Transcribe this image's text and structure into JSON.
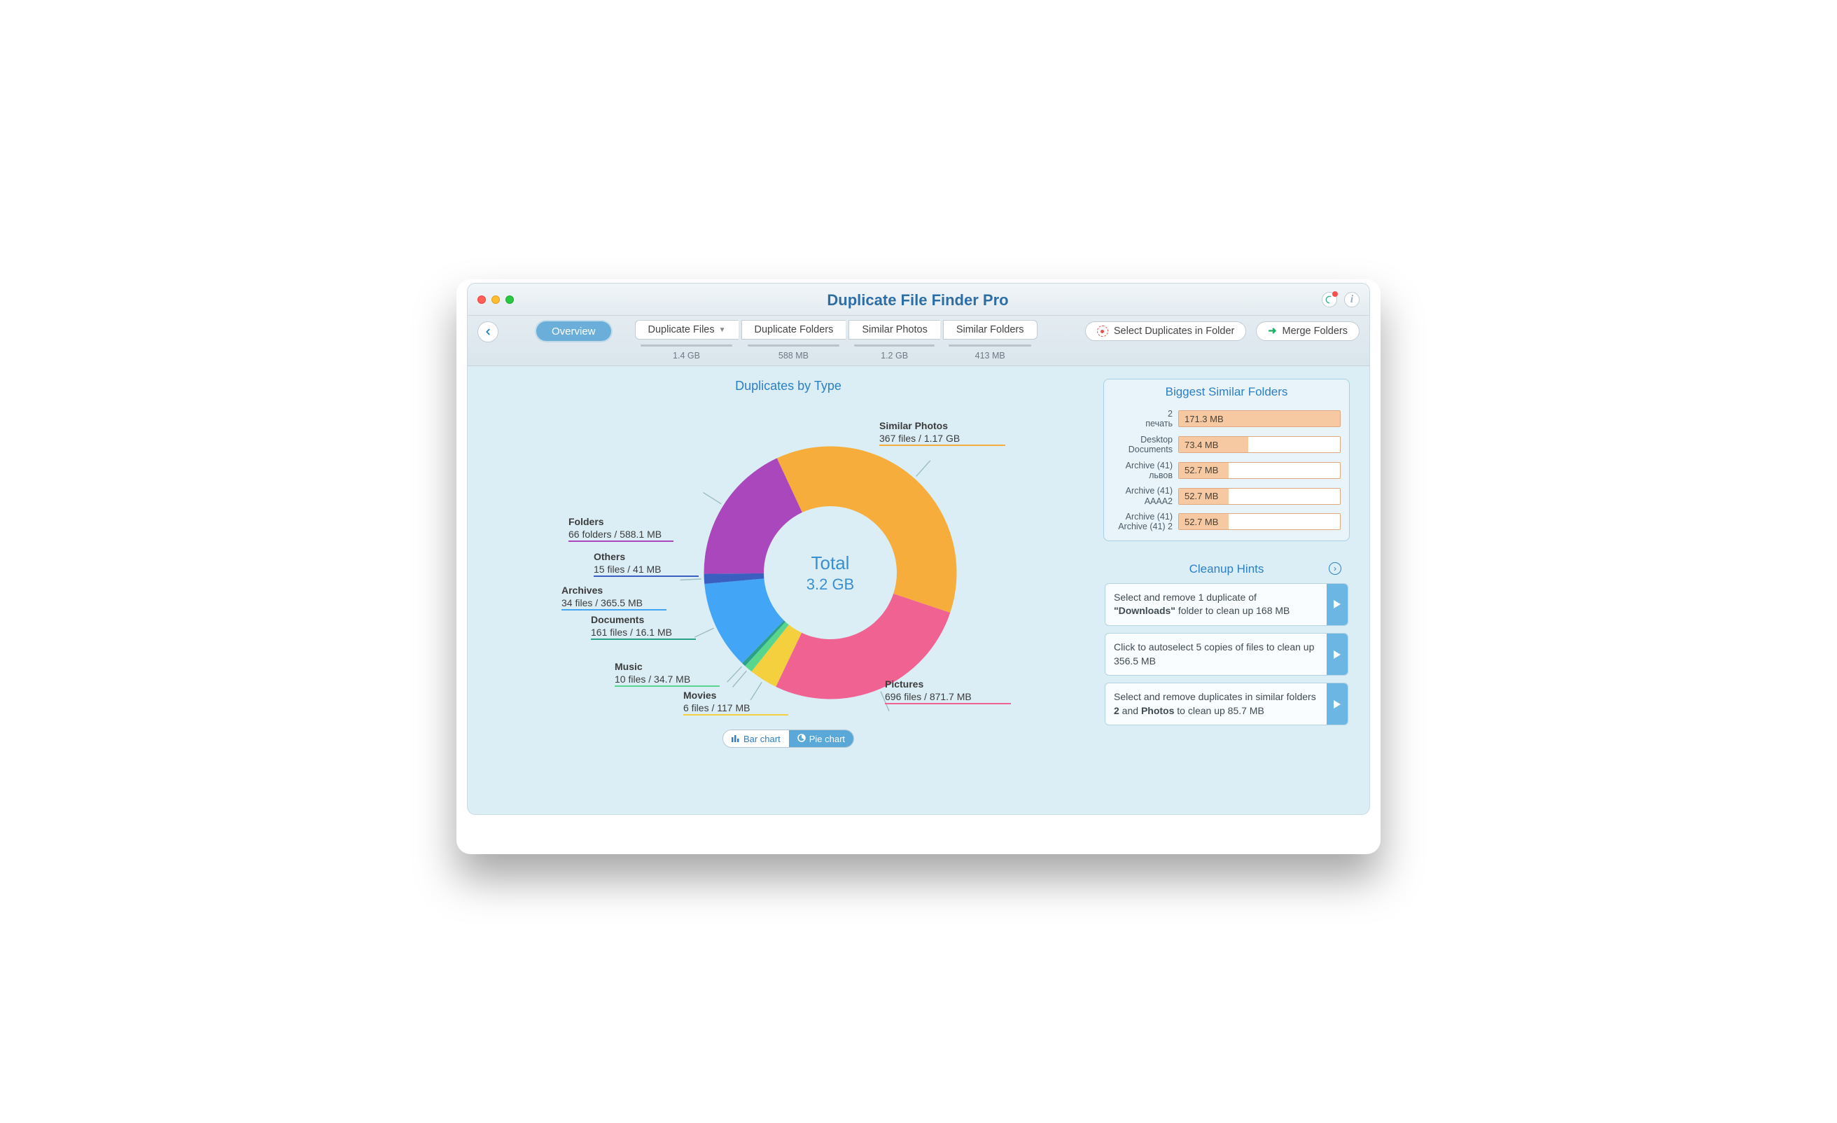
{
  "header": {
    "app_title": "Duplicate File Finder Pro",
    "back_icon": "‹"
  },
  "overview_label": "Overview",
  "tabs": [
    {
      "label": "Duplicate Files",
      "has_dropdown": true,
      "size": "1.4 GB"
    },
    {
      "label": "Duplicate Folders",
      "has_dropdown": false,
      "size": "588 MB"
    },
    {
      "label": "Similar Photos",
      "has_dropdown": false,
      "size": "1.2 GB"
    },
    {
      "label": "Similar Folders",
      "has_dropdown": false,
      "size": "413 MB"
    }
  ],
  "toolbar_actions": {
    "select_in_folder": "Select Duplicates in Folder",
    "merge_folders": "Merge Folders"
  },
  "chart": {
    "title": "Duplicates by Type",
    "center_label": "Total",
    "center_value": "3.2 GB",
    "toggle_bar": "Bar chart",
    "toggle_pie": "Pie chart"
  },
  "chart_data": {
    "type": "pie",
    "title": "Duplicates by Type",
    "total": "3.2 GB",
    "series": [
      {
        "name": "Similar Photos",
        "detail": "367 files / 1.17 GB",
        "value_mb": 1198,
        "color": "#f6ad3c"
      },
      {
        "name": "Pictures",
        "detail": "696 files / 871.7 MB",
        "value_mb": 871.7,
        "color": "#f06292"
      },
      {
        "name": "Movies",
        "detail": "6 files / 117 MB",
        "value_mb": 117,
        "color": "#f4d03f"
      },
      {
        "name": "Music",
        "detail": "10 files / 34.7 MB",
        "value_mb": 34.7,
        "color": "#58d68d"
      },
      {
        "name": "Documents",
        "detail": "161 files / 16.1 MB",
        "value_mb": 16.1,
        "color": "#2ca089"
      },
      {
        "name": "Archives",
        "detail": "34 files / 365.5 MB",
        "value_mb": 365.5,
        "color": "#42a5f5"
      },
      {
        "name": "Others",
        "detail": "15 files / 41 MB",
        "value_mb": 41,
        "color": "#3b5fc0"
      },
      {
        "name": "Folders",
        "detail": "66 folders / 588.1 MB",
        "value_mb": 588.1,
        "color": "#ab47bc"
      }
    ]
  },
  "similar_folders": {
    "title": "Biggest Similar Folders",
    "max_mb": 171.3,
    "rows": [
      {
        "line1": "2",
        "line2": "печать",
        "size_label": "171.3 MB",
        "size_mb": 171.3
      },
      {
        "line1": "Desktop",
        "line2": "Documents",
        "size_label": "73.4 MB",
        "size_mb": 73.4
      },
      {
        "line1": "Archive (41)",
        "line2": "львов",
        "size_label": "52.7 MB",
        "size_mb": 52.7
      },
      {
        "line1": "Archive (41)",
        "line2": "AAAA2",
        "size_label": "52.7 MB",
        "size_mb": 52.7
      },
      {
        "line1": "Archive (41)",
        "line2": "Archive (41) 2",
        "size_label": "52.7 MB",
        "size_mb": 52.7
      }
    ]
  },
  "cleanup": {
    "title": "Cleanup Hints",
    "hints": [
      {
        "html": "Select and remove 1 duplicate of <b>\"Downloads\"</b> folder to clean up 168 MB"
      },
      {
        "html": "Click to autoselect 5 copies of files to clean up 356.5 MB"
      },
      {
        "html": "Select and remove duplicates in similar folders <b>2</b> and <b>Photos</b> to clean up 85.7 MB"
      }
    ]
  }
}
